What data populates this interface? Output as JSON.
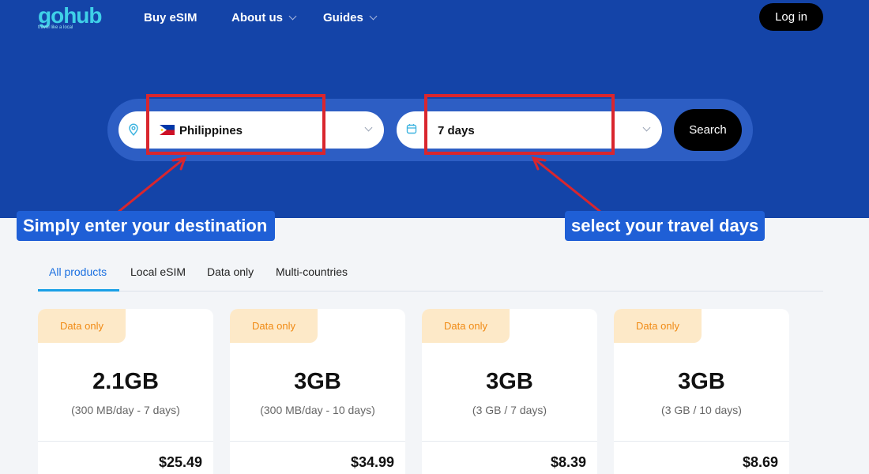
{
  "header": {
    "logo_text": "gohub",
    "logo_tagline": "travel like a local",
    "nav": [
      {
        "label": "Buy eSIM"
      },
      {
        "label": "About us"
      },
      {
        "label": "Guides"
      }
    ],
    "login_label": "Log in"
  },
  "search": {
    "destination_value": "Philippines",
    "days_value": "7 days",
    "button_label": "Search"
  },
  "annotations": {
    "callout_destination": "Simply enter your destination",
    "callout_days": "select your travel days",
    "highlight_color": "#d9262e",
    "callout_color": "#1f5fd6"
  },
  "tabs": [
    {
      "label": "All products",
      "active": true
    },
    {
      "label": "Local eSIM"
    },
    {
      "label": "Data only"
    },
    {
      "label": "Multi-countries"
    }
  ],
  "products": [
    {
      "badge": "Data only",
      "data": "2.1GB",
      "detail": "(300 MB/day - 7 days)",
      "price": "$25.49"
    },
    {
      "badge": "Data only",
      "data": "3GB",
      "detail": "(300 MB/day - 10 days)",
      "price": "$34.99"
    },
    {
      "badge": "Data only",
      "data": "3GB",
      "detail": "(3 GB / 7 days)",
      "price": "$8.39"
    },
    {
      "badge": "Data only",
      "data": "3GB",
      "detail": "(3 GB / 10 days)",
      "price": "$8.69"
    }
  ],
  "colors": {
    "hero_bg": "#1444a8",
    "accent": "#1a6fe0",
    "logo": "#3fd0e8",
    "badge_bg": "#fde9c8",
    "badge_text": "#f08a14"
  }
}
